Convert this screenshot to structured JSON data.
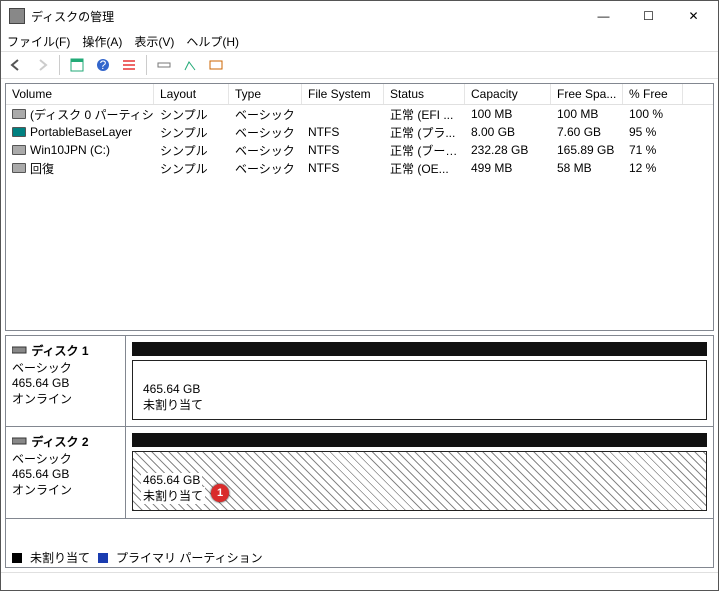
{
  "window": {
    "title": "ディスクの管理",
    "min": "—",
    "max": "☐",
    "close": "✕"
  },
  "menu": {
    "file": "ファイル(F)",
    "action": "操作(A)",
    "view": "表示(V)",
    "help": "ヘルプ(H)"
  },
  "vol_headers": [
    "Volume",
    "Layout",
    "Type",
    "File System",
    "Status",
    "Capacity",
    "Free Spa...",
    "% Free"
  ],
  "volumes": [
    {
      "name": "(ディスク 0 パーティシ...",
      "layout": "シンプル",
      "type": "ベーシック",
      "fs": "",
      "status": "正常 (EFI ...",
      "cap": "100 MB",
      "free": "100 MB",
      "pct": "100 %",
      "icon": ""
    },
    {
      "name": "PortableBaseLayer",
      "layout": "シンプル",
      "type": "ベーシック",
      "fs": "NTFS",
      "status": "正常 (プラ...",
      "cap": "8.00 GB",
      "free": "7.60 GB",
      "pct": "95 %",
      "icon": "teal"
    },
    {
      "name": "Win10JPN (C:)",
      "layout": "シンプル",
      "type": "ベーシック",
      "fs": "NTFS",
      "status": "正常 (ブート...",
      "cap": "232.28 GB",
      "free": "165.89 GB",
      "pct": "71 %",
      "icon": ""
    },
    {
      "name": "回復",
      "layout": "シンプル",
      "type": "ベーシック",
      "fs": "NTFS",
      "status": "正常 (OE...",
      "cap": "499 MB",
      "free": "58 MB",
      "pct": "12 %",
      "icon": ""
    }
  ],
  "disks": [
    {
      "name": "ディスク 1",
      "type": "ベーシック",
      "size": "465.64 GB",
      "status": "オンライン",
      "part": {
        "size": "465.64 GB",
        "label": "未割り当て",
        "hatched": false
      }
    },
    {
      "name": "ディスク 2",
      "type": "ベーシック",
      "size": "465.64 GB",
      "status": "オンライン",
      "part": {
        "size": "465.64 GB",
        "label": "未割り当て",
        "hatched": true,
        "callout": "1"
      }
    }
  ],
  "legend": {
    "unallocated": "未割り当て",
    "primary": "プライマリ パーティション"
  }
}
